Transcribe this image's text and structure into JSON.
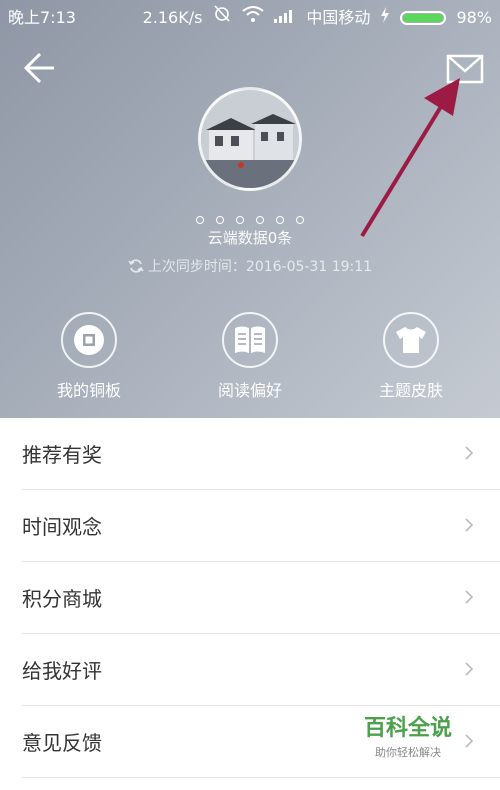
{
  "status_bar": {
    "time": "晚上7:13",
    "net_speed": "2.16K/s",
    "carrier": "中国移动",
    "battery": "98%"
  },
  "profile": {
    "cloud_count": "云端数据0条",
    "last_sync": "上次同步时间：2016-05-31 19:11"
  },
  "shortcuts": [
    {
      "label": "我的铜板",
      "icon": "coin-icon"
    },
    {
      "label": "阅读偏好",
      "icon": "book-icon"
    },
    {
      "label": "主题皮肤",
      "icon": "shirt-icon"
    }
  ],
  "menu": [
    {
      "label": "推荐有奖"
    },
    {
      "label": "时间观念"
    },
    {
      "label": "积分商城"
    },
    {
      "label": "给我好评"
    },
    {
      "label": "意见反馈"
    }
  ],
  "watermark": {
    "title": "百科全说",
    "subtitle": "助你轻松解决"
  },
  "colors": {
    "annotation_arrow": "#9b1b45",
    "battery": "#5bd85b",
    "header_bg": "#a5adb9"
  }
}
